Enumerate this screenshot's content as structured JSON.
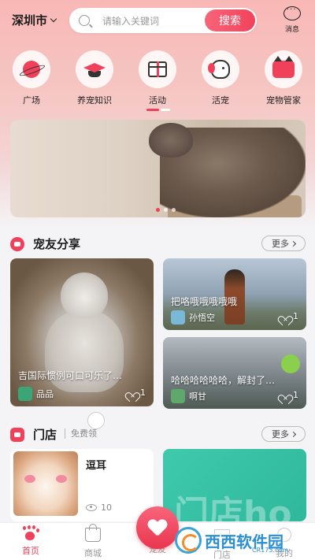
{
  "header": {
    "city": "深圳市",
    "search_placeholder": "请输入关键词",
    "search_button": "搜索",
    "message_label": "消息"
  },
  "categories": [
    {
      "label": "广场",
      "icon": "planet-icon"
    },
    {
      "label": "养宠知识",
      "icon": "graduation-cap-icon"
    },
    {
      "label": "活动",
      "icon": "gift-icon"
    },
    {
      "label": "活宠",
      "icon": "dog-icon"
    },
    {
      "label": "宠物管家",
      "icon": "cat-icon"
    }
  ],
  "share_section": {
    "title": "宠友分享",
    "more": "更多",
    "posts": [
      {
        "text": "吉国际惯例可口可乐了…",
        "author": "品品",
        "likes": "1"
      },
      {
        "text": "把咯哦哦哦哦哦",
        "author": "孙悟空",
        "likes": "1"
      },
      {
        "text": "哈哈哈哈哈哈，解封了…",
        "author": "啊甘",
        "likes": "1"
      }
    ]
  },
  "store_section": {
    "title": "门店",
    "subtitle": "免费领",
    "more": "更多",
    "stores": [
      {
        "name": "逗耳",
        "views": "10"
      }
    ],
    "promo_text": "门店ho"
  },
  "tabbar": {
    "items": [
      {
        "label": "首页",
        "active": true
      },
      {
        "label": "商城",
        "active": false
      },
      {
        "label": "宠友",
        "active": false
      },
      {
        "label": "门店",
        "active": false
      },
      {
        "label": "我的",
        "active": false
      }
    ]
  },
  "watermark": {
    "text": "西西软件园",
    "url": "CR173.com"
  },
  "colors": {
    "accent": "#f0405a",
    "header_gradient_top": "#f8b8b6",
    "background": "#f4f4f6"
  }
}
